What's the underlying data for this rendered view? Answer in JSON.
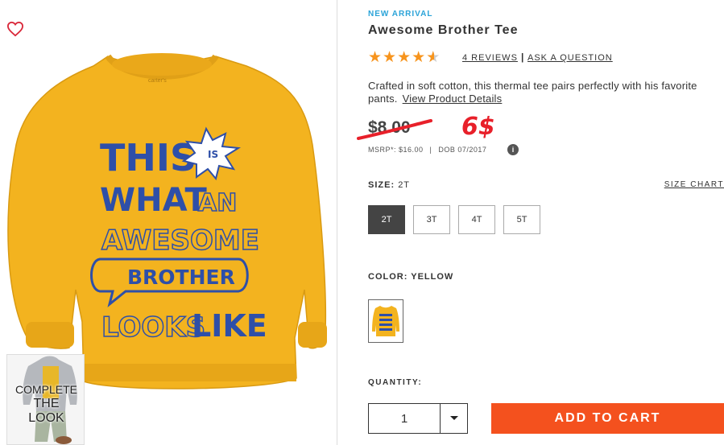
{
  "product": {
    "badge": "NEW ARRIVAL",
    "title": "Awesome Brother Tee",
    "rating": 4.5,
    "rating_max": 5,
    "reviews_link": "4 REVIEWS",
    "ask_link": "ASK A QUESTION",
    "description": "Crafted in soft cotton, this thermal tee pairs perfectly with his favorite pants.",
    "details_link": "View Product Details",
    "original_price": "$8.00",
    "handwritten_price": "6$",
    "msrp": "MSRP*: $16.00",
    "dob": "DOB 07/2017",
    "info_icon_glyph": "i"
  },
  "shirt_print": {
    "line1": "THIS",
    "burst": "IS",
    "line2a": "WHAT",
    "line2b": "AN",
    "line3": "AWESOME",
    "line4": "BROTHER",
    "line5a": "LOOKS",
    "line5b": "LIKE",
    "tag": "carter's"
  },
  "complete_look": {
    "line1": "COMPLETE",
    "line2": "THE",
    "line3": "LOOK"
  },
  "size": {
    "label": "SIZE:",
    "selected": "2T",
    "chart_link": "SIZE CHART",
    "options": [
      "2T",
      "3T",
      "4T",
      "5T"
    ]
  },
  "color": {
    "label": "COLOR: YELLOW"
  },
  "quantity": {
    "label": "QUANTITY:",
    "value": "1"
  },
  "cart": {
    "button": "ADD TO CART"
  },
  "colors": {
    "shirt": "#f3b31f",
    "print_blue": "#2e4fa8",
    "cta": "#f4511e",
    "accent_blue": "#2aa3d8",
    "star": "#f7941d",
    "strike_red": "#e8202a"
  },
  "icons": {
    "wishlist": "heart-outline-icon",
    "quantity": "chevron-down-icon",
    "info": "info-icon"
  }
}
